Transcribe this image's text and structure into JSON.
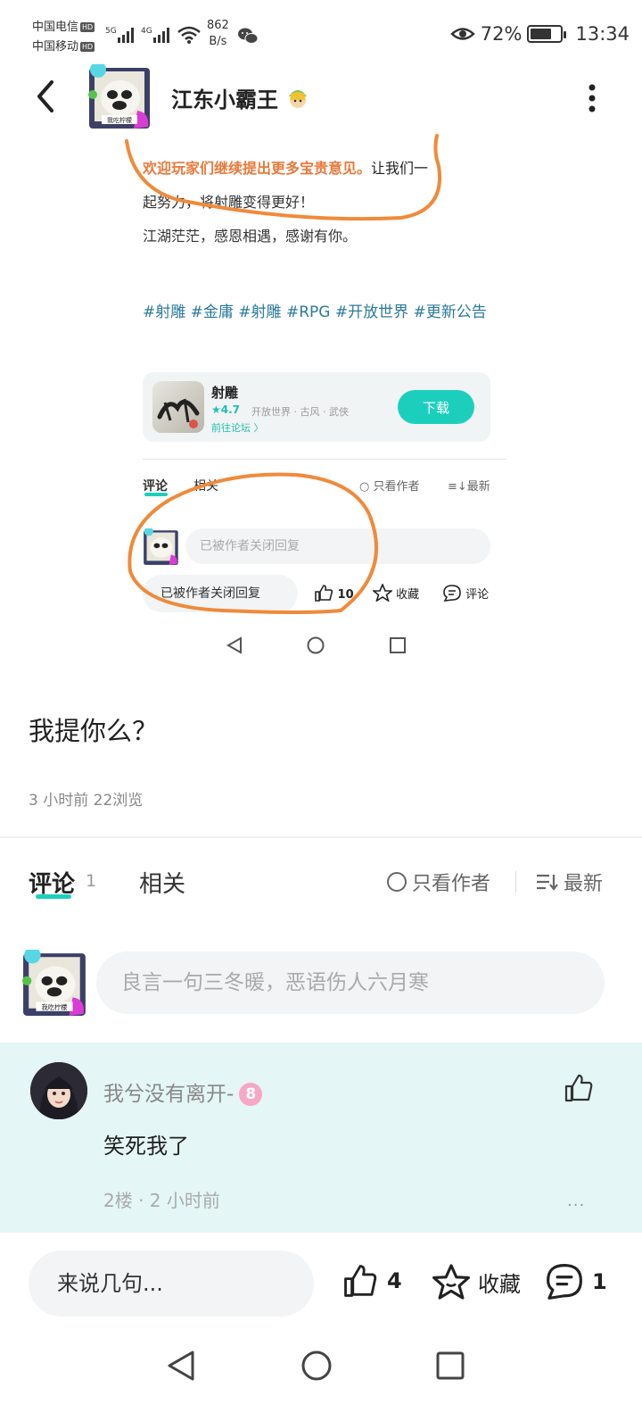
{
  "status_bar": {
    "carrier1": "中国电信",
    "carrier2": "中国移动",
    "hd_badge": "HD",
    "net1": "5G",
    "net2": "4G",
    "speed_value": "862",
    "speed_unit": "B/s",
    "battery_percent": "72%",
    "battery_level": 0.72,
    "time": "13:34"
  },
  "header": {
    "username": "江东小霸王",
    "avatar_badge": "我吃柠檬"
  },
  "embedded": {
    "highlight_text": "欢迎玩家们继续提出更多宝贵意见。",
    "line1_rest": "让我们一",
    "line2": "起努力，将射雕变得更好！",
    "line3": "江湖茫茫，感恩相遇，感谢有你。",
    "tags": "#射雕 #金庸 #射雕 #RPG #开放世界 #更新公告",
    "game": {
      "name": "射雕",
      "rating": "★4.7",
      "genres": "开放世界 · 古风 · 武侠",
      "forum_link": "前往论坛 〉",
      "download": "下载"
    },
    "tabs": {
      "comment": "评论",
      "related": "相关",
      "only_author": "只看作者",
      "latest": "最新"
    },
    "input_placeholder": "已被作者关闭回复",
    "bottom": {
      "pill": "已被作者关闭回复",
      "likes": "10",
      "favorite": "收藏",
      "comment": "评论"
    }
  },
  "post": {
    "title": "我提你么？",
    "meta": "3 小时前  22浏览"
  },
  "tabs": {
    "comment": "评论",
    "comment_count": "1",
    "related": "相关",
    "only_author": "只看作者",
    "latest": "最新"
  },
  "comment_input": {
    "placeholder": "良言一句三冬暖，恶语伤人六月寒"
  },
  "comment": {
    "author": "我兮没有离开-",
    "level": "8",
    "text": "笑死我了",
    "meta": "2楼 · 2 小时前",
    "more": "···"
  },
  "bottom_bar": {
    "input_placeholder": "来说几句...",
    "likes": "4",
    "favorite": "收藏",
    "comments": "1"
  },
  "colors": {
    "accent": "#1ccfbd",
    "highlight": "#e87a3c",
    "tag": "#2b7a9a",
    "scribble": "#f08a3a",
    "comment_bg": "#e4f6f6"
  }
}
